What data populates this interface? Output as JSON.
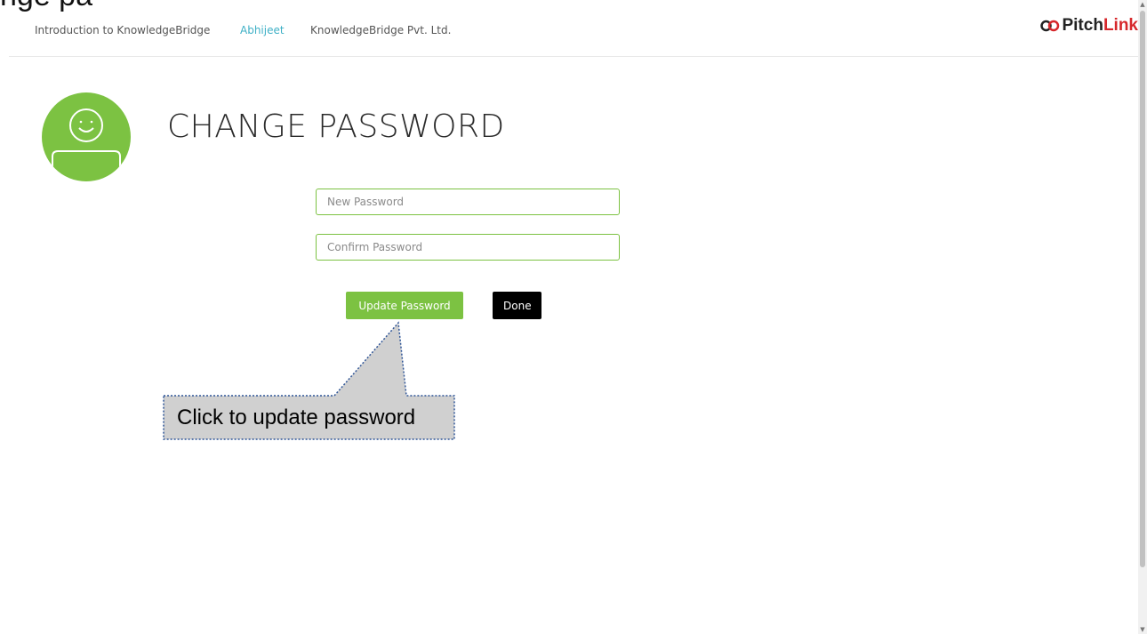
{
  "header_clipped_text": "nge pa",
  "nav": {
    "items": [
      {
        "label": "Introduction to KnowledgeBridge",
        "active": false
      },
      {
        "label": "Abhijeet",
        "active": true
      },
      {
        "label": "KnowledgeBridge Pvt. Ltd.",
        "active": false
      }
    ],
    "logo": {
      "pitch": "Pitch",
      "link": "Link"
    }
  },
  "page": {
    "title": "CHANGE PASSWORD"
  },
  "form": {
    "new_password_placeholder": "New Password",
    "confirm_password_placeholder": "Confirm Password",
    "update_label": "Update Password",
    "done_label": "Done"
  },
  "callout": {
    "text": "Click to update password"
  },
  "colors": {
    "accent_green": "#7cc242",
    "active_nav": "#3fb0c6",
    "logo_red": "#d6272b",
    "callout_fill": "#d0d0d0",
    "callout_border": "#2f5597"
  }
}
